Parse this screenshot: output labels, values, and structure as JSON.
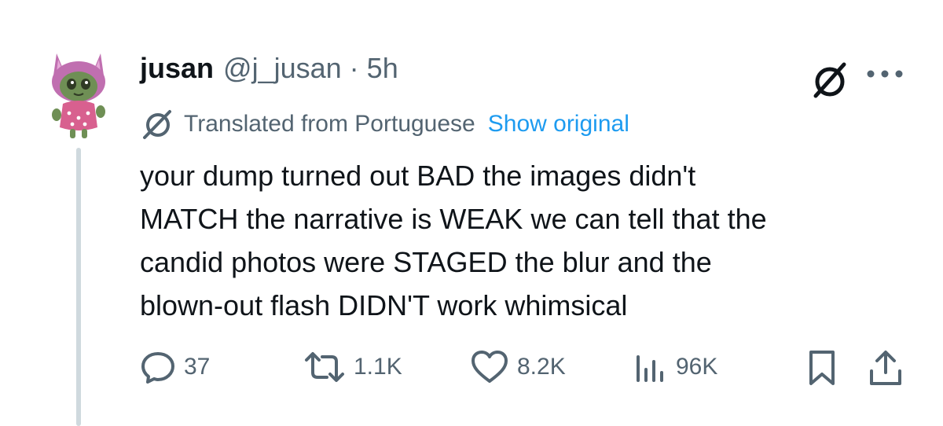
{
  "tweet": {
    "display_name": "jusan",
    "handle": "@j_jusan",
    "separator": "·",
    "time": "5h",
    "translation": {
      "label": "Translated from Portuguese",
      "show_original": "Show original"
    },
    "body_lines": [
      "your dump turned out BAD the images didn't",
      "MATCH the narrative is WEAK we can tell that the",
      "candid photos were STAGED the blur and the",
      "blown-out flash DIDN'T work whimsical"
    ]
  },
  "actions": {
    "replies": "37",
    "reposts": "1.1K",
    "likes": "8.2K",
    "views": "96K"
  },
  "icons": {
    "avatar": "cat-avatar",
    "grok": "grok-icon",
    "more": "more-icon",
    "reply": "reply-icon",
    "repost": "repost-icon",
    "like": "heart-icon",
    "views": "views-icon",
    "bookmark": "bookmark-icon",
    "share": "share-icon"
  },
  "colors": {
    "text": "#0f1419",
    "secondary": "#536471",
    "link": "#1d9bf0",
    "thread_line": "#cfd9de"
  }
}
